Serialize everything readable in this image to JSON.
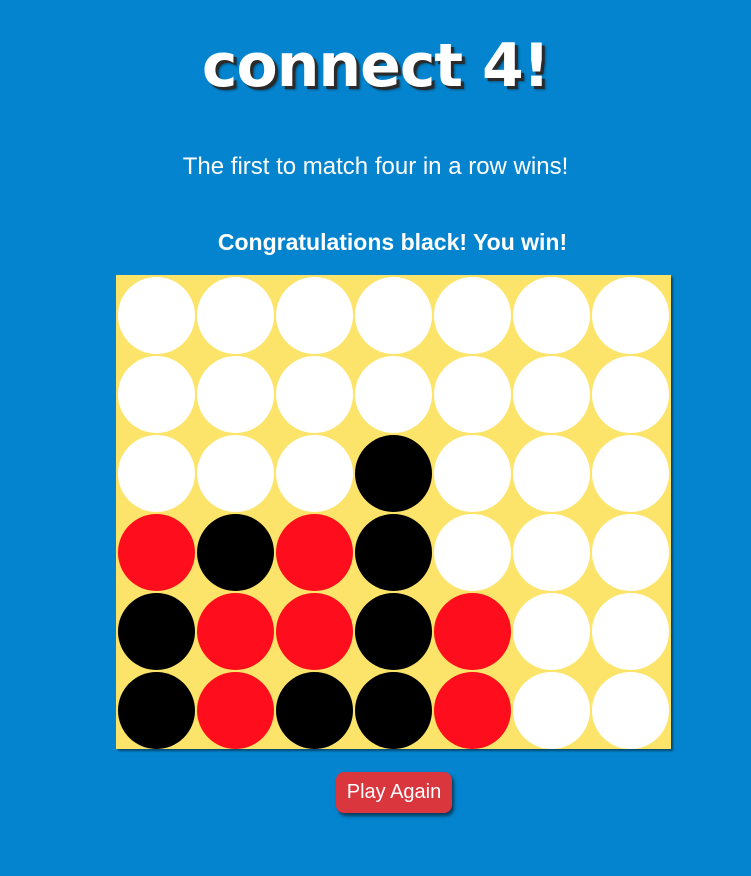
{
  "header": {
    "title": "Connect 4!",
    "subtitle": "The first to match four in a row wins!"
  },
  "status": {
    "message": "Congratulations black! You win!"
  },
  "board": {
    "columns": 7,
    "rows": [
      [
        "empty",
        "empty",
        "empty",
        "empty",
        "empty",
        "empty",
        "empty"
      ],
      [
        "empty",
        "empty",
        "empty",
        "empty",
        "empty",
        "empty",
        "empty"
      ],
      [
        "empty",
        "empty",
        "empty",
        "black",
        "empty",
        "empty",
        "empty"
      ],
      [
        "red",
        "black",
        "red",
        "black",
        "empty",
        "empty",
        "empty"
      ],
      [
        "black",
        "red",
        "red",
        "black",
        "red",
        "empty",
        "empty"
      ],
      [
        "black",
        "red",
        "black",
        "black",
        "red",
        "empty",
        "empty"
      ]
    ],
    "colors": {
      "board": "#fce46a",
      "red": "#fe0d1c",
      "black": "#000000",
      "empty": "#ffffff"
    }
  },
  "controls": {
    "play_again_label": "Play Again",
    "button_color": "#d9363e"
  },
  "theme": {
    "background": "#0484ce"
  }
}
